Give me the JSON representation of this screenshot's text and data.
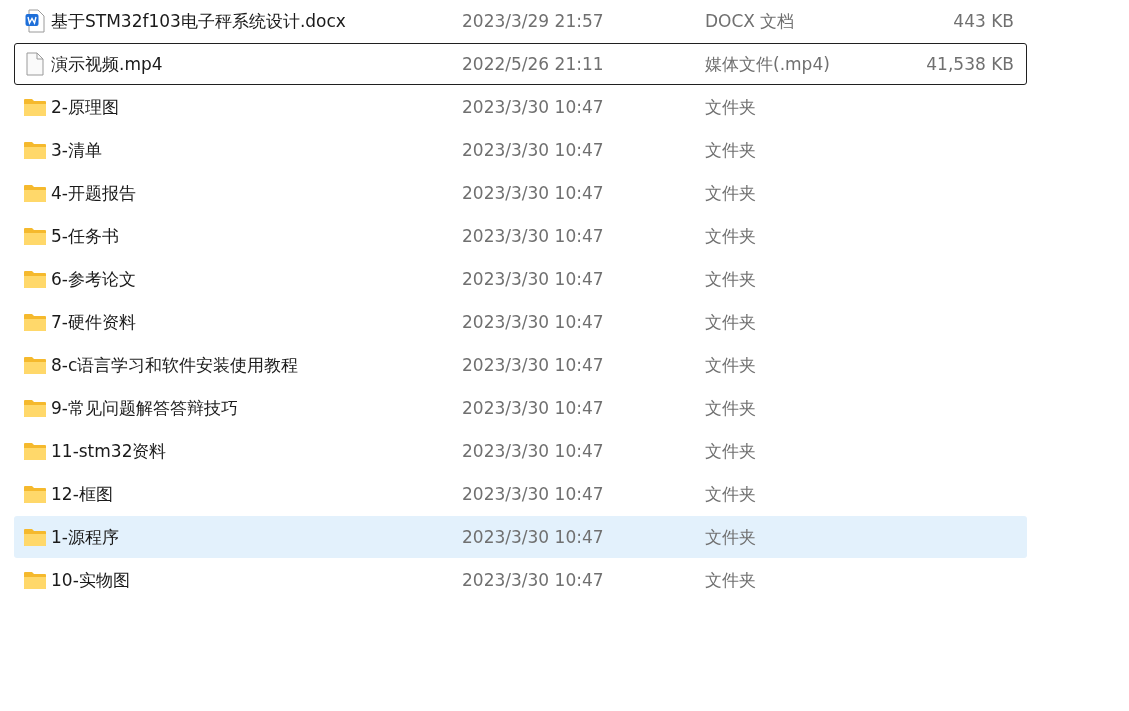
{
  "files": [
    {
      "kind": "word",
      "name": "基于STM32f103电子秤系统设计.docx",
      "date": "2023/3/29 21:57",
      "type": "DOCX 文档",
      "size": "443 KB",
      "selected": false,
      "focused": false
    },
    {
      "kind": "file",
      "name": "演示视频.mp4",
      "date": "2022/5/26 21:11",
      "type": "媒体文件(.mp4)",
      "size": "41,538 KB",
      "selected": false,
      "focused": true
    },
    {
      "kind": "folder",
      "name": "2-原理图",
      "date": "2023/3/30 10:47",
      "type": "文件夹",
      "selected": false,
      "focused": false
    },
    {
      "kind": "folder",
      "name": "3-清单",
      "date": "2023/3/30 10:47",
      "type": "文件夹",
      "selected": false,
      "focused": false
    },
    {
      "kind": "folder",
      "name": "4-开题报告",
      "date": "2023/3/30 10:47",
      "type": "文件夹",
      "selected": false,
      "focused": false
    },
    {
      "kind": "folder",
      "name": "5-任务书",
      "date": "2023/3/30 10:47",
      "type": "文件夹",
      "selected": false,
      "focused": false
    },
    {
      "kind": "folder",
      "name": "6-参考论文",
      "date": "2023/3/30 10:47",
      "type": "文件夹",
      "selected": false,
      "focused": false
    },
    {
      "kind": "folder",
      "name": "7-硬件资料",
      "date": "2023/3/30 10:47",
      "type": "文件夹",
      "selected": false,
      "focused": false
    },
    {
      "kind": "folder",
      "name": "8-c语言学习和软件安装使用教程",
      "date": "2023/3/30 10:47",
      "type": "文件夹",
      "selected": false,
      "focused": false
    },
    {
      "kind": "folder",
      "name": "9-常见问题解答答辩技巧",
      "date": "2023/3/30 10:47",
      "type": "文件夹",
      "selected": false,
      "focused": false
    },
    {
      "kind": "folder",
      "name": "11-stm32资料",
      "date": "2023/3/30 10:47",
      "type": "文件夹",
      "selected": false,
      "focused": false
    },
    {
      "kind": "folder",
      "name": "12-框图",
      "date": "2023/3/30 10:47",
      "type": "文件夹",
      "selected": false,
      "focused": false
    },
    {
      "kind": "folder",
      "name": "1-源程序",
      "date": "2023/3/30 10:47",
      "type": "文件夹",
      "selected": true,
      "focused": false
    },
    {
      "kind": "folder",
      "name": "10-实物图",
      "date": "2023/3/30 10:47",
      "type": "文件夹",
      "selected": false,
      "focused": false
    }
  ]
}
